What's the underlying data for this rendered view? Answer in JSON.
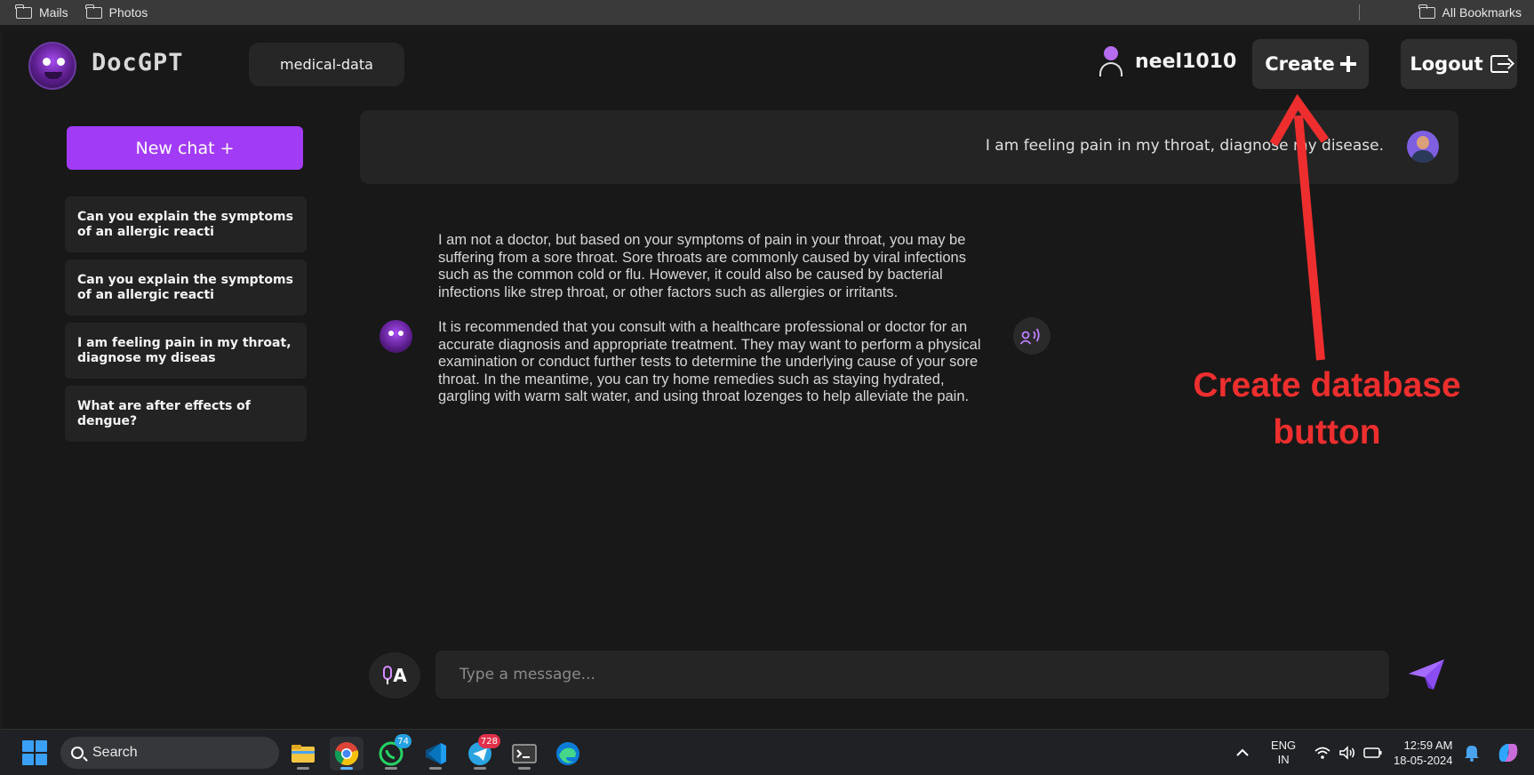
{
  "bookmarks": {
    "items": [
      {
        "label": "Mails"
      },
      {
        "label": "Photos"
      }
    ],
    "all_bookmarks": "All Bookmarks"
  },
  "header": {
    "brand": "DocGPT",
    "database": "medical-data",
    "username": "neel1010",
    "create_label": "Create",
    "logout_label": "Logout"
  },
  "sidebar": {
    "new_chat": "New chat +",
    "history": [
      {
        "label": "Can you explain the symptoms of an allergic reacti"
      },
      {
        "label": "Can you explain the symptoms of an allergic reacti"
      },
      {
        "label": "I am feeling pain in my throat, diagnose my diseas"
      },
      {
        "label": "What are after effects of dengue?"
      }
    ]
  },
  "chat": {
    "user_message": "I am feeling pain in my throat, diagnose my disease.",
    "bot_paragraphs": [
      "I am not a doctor, but based on your symptoms of pain in your throat, you may be suffering from a sore throat. Sore throats are commonly caused by viral infections such as the common cold or flu. However, it could also be caused by bacterial infections like strep throat, or other factors such as allergies or irritants.",
      "It is recommended that you consult with a healthcare professional or doctor for an accurate diagnosis and appropriate treatment. They may want to perform a physical examination or conduct further tests to determine the underlying cause of your sore throat. In the meantime, you can try home remedies such as staying hydrated, gargling with warm salt water, and using throat lozenges to help alleviate the pain."
    ]
  },
  "input": {
    "placeholder": "Type a message...",
    "mic_label": "A"
  },
  "annotation": {
    "line1": "Create database",
    "line2": "button",
    "color": "#ee2e2e"
  },
  "taskbar": {
    "search_label": "Search",
    "whatsapp_badge": "74",
    "telegram_badge": "728",
    "language": "ENG",
    "region": "IN",
    "time": "12:59 AM",
    "date": "18-05-2024"
  },
  "colors": {
    "accent": "#a23bf5",
    "background": "#181818"
  }
}
